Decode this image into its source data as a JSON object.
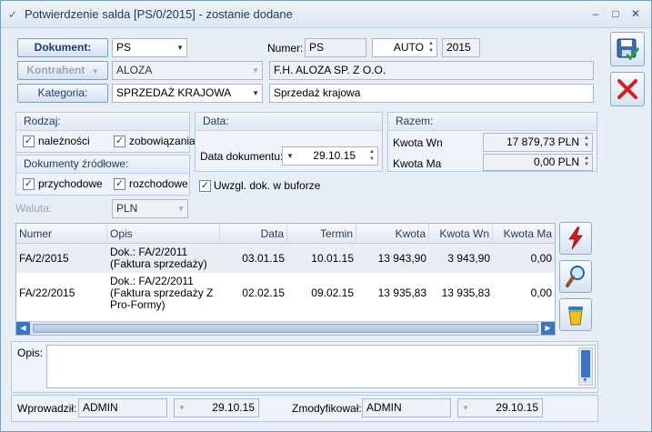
{
  "window": {
    "title": "Potwierdzenie salda [PS/0/2015] - zostanie dodane",
    "minimize": "–",
    "maximize": "□",
    "close": "✕"
  },
  "header": {
    "dokument_label": "Dokument:",
    "dokument_value": "PS",
    "kontrahent_label": "Kontrahent",
    "kontrahent_value": "ALOZA",
    "kontrahent_name": "F.H. ALOZA SP. Z O.O.",
    "kategoria_label": "Kategoria:",
    "kategoria_value": "SPRZEDAŻ KRAJOWA",
    "kategoria_desc": "Sprzedaż krajowa",
    "numer_label": "Numer:",
    "numer_prefix": "PS",
    "numer_auto": "AUTO",
    "numer_year": "2015"
  },
  "rodzaj": {
    "title": "Rodzaj:",
    "naleznosci": "należności",
    "zobowiazania": "zobowiązania"
  },
  "zrodlowe": {
    "title": "Dokumenty źródłowe:",
    "przychodowe": "przychodowe",
    "rozchodowe": "rozchodowe"
  },
  "data": {
    "title": "Data:",
    "label": "Data dokumentu:",
    "value": "29.10.15",
    "bufor_label": "Uwzgl. dok. w buforze"
  },
  "razem": {
    "title": "Razem:",
    "wn_label": "Kwota Wn",
    "wn_value": "17 879,73 PLN",
    "ma_label": "Kwota Ma",
    "ma_value": "0,00 PLN"
  },
  "waluta": {
    "label": "Waluta:",
    "value": "PLN"
  },
  "grid": {
    "headers": [
      "Numer",
      "Opis",
      "Data",
      "Termin",
      "Kwota",
      "Kwota Wn",
      "Kwota Ma"
    ],
    "rows": [
      {
        "numer": "FA/2/2015",
        "opis": "Dok.: FA/2/2011 (Faktura sprzedaży)",
        "data": "03.01.15",
        "termin": "10.01.15",
        "kwota": "13 943,90",
        "wn": "3 943,90",
        "ma": "0,00"
      },
      {
        "numer": "FA/22/2015",
        "opis": "Dok.: FA/22/2011 (Faktura sprzedaży Z Pro-Formy)",
        "data": "02.02.15",
        "termin": "09.02.15",
        "kwota": "13 935,83",
        "wn": "13 935,83",
        "ma": "0,00"
      }
    ]
  },
  "opis": {
    "label": "Opis:"
  },
  "footer": {
    "wprowadzil_label": "Wprowadził:",
    "wprowadzil_user": "ADMIN",
    "wprowadzil_date": "29.10.15",
    "zmodyfikowal_label": "Zmodyfikował:",
    "zmodyfikowal_user": "ADMIN",
    "zmodyfikowal_date": "29.10.15"
  },
  "colors": {
    "accent": "#1a3e73",
    "cancel": "#d42020",
    "flash": "#d41e1e"
  }
}
